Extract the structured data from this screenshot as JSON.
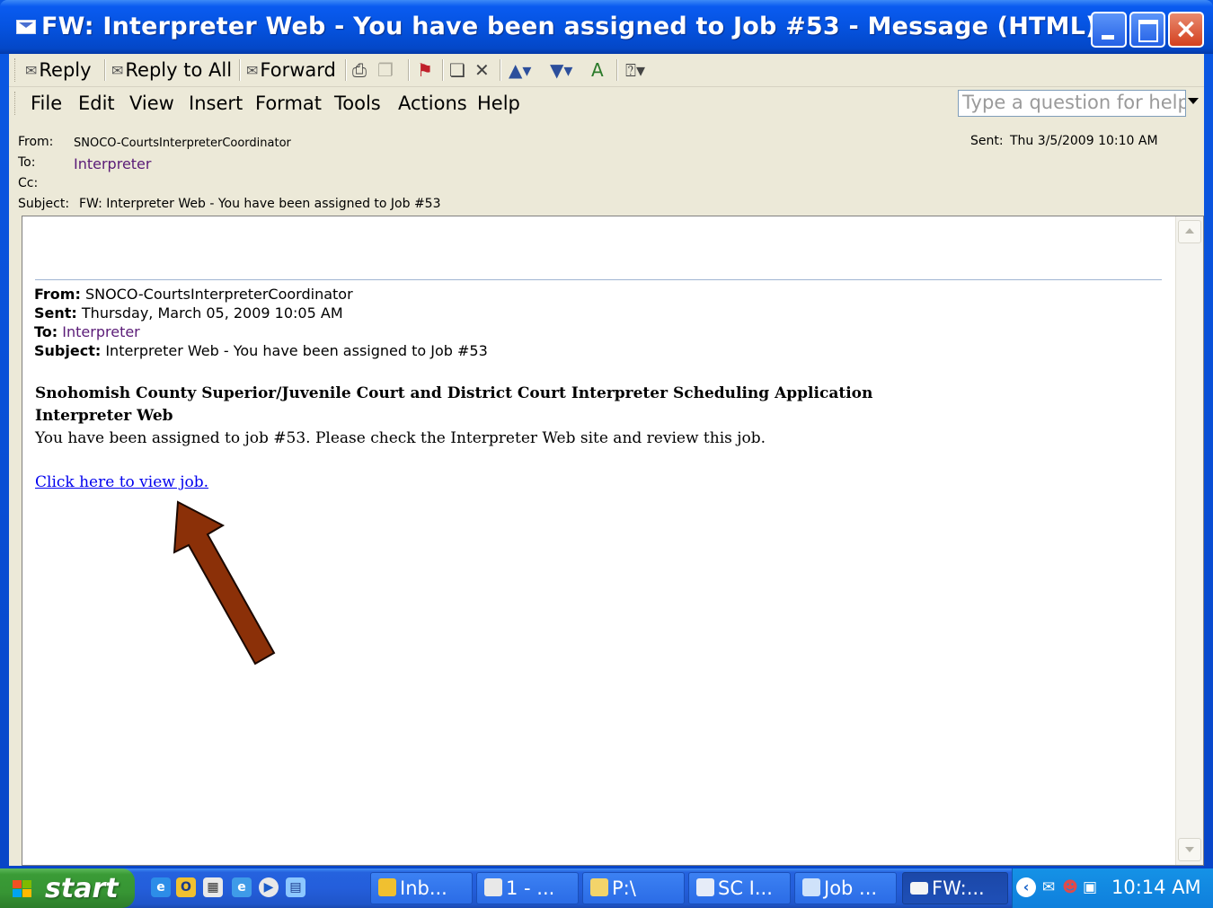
{
  "window": {
    "title": "FW: Interpreter Web - You have been assigned to Job #53 - Message (HTML)"
  },
  "toolbar": {
    "reply": "Reply",
    "reply_all": "Reply to All",
    "forward": "Forward"
  },
  "menu": [
    "File",
    "Edit",
    "View",
    "Insert",
    "Format",
    "Tools",
    "Actions",
    "Help"
  ],
  "help_placeholder": "Type a question for help",
  "header": {
    "from_label": "From:",
    "from_value": "SNOCO-CourtsInterpreterCoordinator",
    "to_label": "To:",
    "to_value": "Interpreter",
    "cc_label": "Cc:",
    "subject_label": "Subject:",
    "subject_value": "FW: Interpreter Web - You have been assigned to Job #53",
    "sent_label": "Sent:",
    "sent_value": "Thu 3/5/2009 10:10 AM"
  },
  "message": {
    "fwd_from_label": "From:",
    "fwd_from": "SNOCO-CourtsInterpreterCoordinator",
    "fwd_sent_label": "Sent:",
    "fwd_sent": "Thursday, March 05, 2009 10:05 AM",
    "fwd_to_label": "To:",
    "fwd_to": "Interpreter",
    "fwd_subject_label": "Subject:",
    "fwd_subject": "Interpreter Web - You have been assigned to Job #53",
    "heading1": "Snohomish County Superior/Juvenile Court and District Court Interpreter Scheduling Application",
    "heading2": "Interpreter Web",
    "body": "You have been assigned to job #53. Please check the Interpreter Web site and review this job.",
    "link": "Click here to view job."
  },
  "taskbar": {
    "start": "start",
    "tasks": [
      "Inb...",
      "1 - ...",
      "P:\\",
      "SC I...",
      "Job ...",
      "FW:..."
    ],
    "clock": "10:14 AM"
  },
  "colors": {
    "title_blue": "#0553e0",
    "link": "#0000ee",
    "arrow": "#8b3008",
    "recipient_purple": "#5a1b77"
  }
}
